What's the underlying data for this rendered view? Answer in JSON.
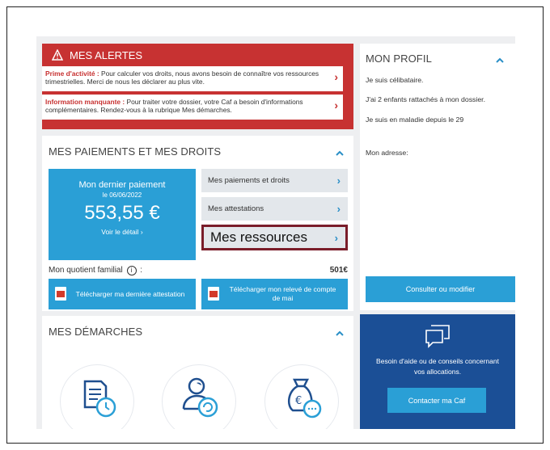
{
  "alerts": {
    "title": "MES ALERTES",
    "items": [
      {
        "label": "Prime d'activité :",
        "text": " Pour calculer vos droits, nous avons besoin de connaître vos ressources trimestrielles. Merci de nous les déclarer au plus vite."
      },
      {
        "label": "Information manquante :",
        "text": " Pour traiter votre dossier, votre Caf a besoin d'informations complémentaires. Rendez-vous à la rubrique Mes démarches."
      }
    ],
    "chevron": "›"
  },
  "paiements": {
    "title": "MES PAIEMENTS ET MES DROITS",
    "chevron": "^",
    "card": {
      "label": "Mon dernier paiement",
      "date": "le 06/06/2022",
      "amount": "553,55 €",
      "detail": "Voir le détail ›"
    },
    "links": [
      "Mes paiements et droits",
      "Mes attestations",
      "Mes ressources"
    ],
    "quotient_label": "Mon quotient familial",
    "quotient_info": "i",
    "quotient_colon": " :",
    "quotient_value": "501€",
    "downloads": [
      "Télécharger ma dernière attestation",
      "Télécharger mon relevé de compte de mai"
    ]
  },
  "demarches": {
    "title": "MES DÉMARCHES",
    "chevron": "^"
  },
  "profil": {
    "title": "MON PROFIL",
    "chevron": "^",
    "lines": [
      "Je suis célibataire.",
      "J'ai 2 enfants rattachés à mon dossier.",
      "Je suis en maladie depuis le 29",
      "Mon adresse:"
    ],
    "button": "Consulter ou modifier"
  },
  "aide": {
    "text": "Besoin d'aide ou de conseils concernant vos allocations.",
    "button": "Contacter ma Caf"
  },
  "icons": [
    "warning-icon",
    "chevron-right-icon",
    "chevron-up-icon",
    "info-icon",
    "pdf-icon",
    "document-clock-icon",
    "user-refresh-icon",
    "money-bag-chat-icon",
    "chat-bubble-icon"
  ],
  "colors": {
    "alert_red": "#c73232",
    "primary_blue": "#2a9fd6",
    "dark_blue": "#1b4f96",
    "highlight_border": "#7a1d2a"
  }
}
